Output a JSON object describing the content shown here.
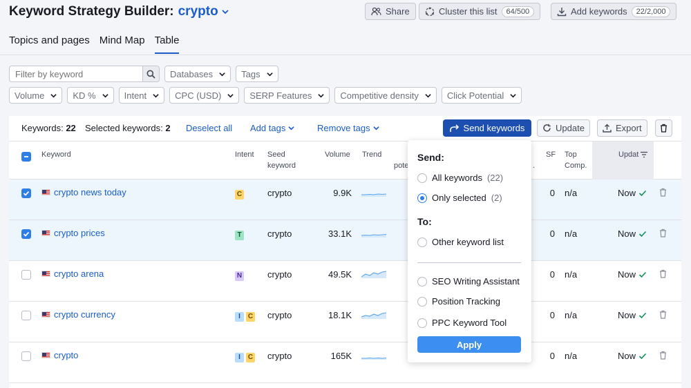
{
  "header": {
    "title": "Keyword Strategy Builder:",
    "project": "crypto",
    "share": "Share",
    "cluster": "Cluster this list",
    "cluster_count": "64/500",
    "add": "Add keywords",
    "add_count": "22/2,000"
  },
  "tabs": [
    {
      "label": "Topics and pages"
    },
    {
      "label": "Mind Map"
    },
    {
      "label": "Table",
      "active": true
    }
  ],
  "filters": {
    "search_placeholder": "Filter by keyword",
    "row1": [
      "Databases",
      "Tags"
    ],
    "row2": [
      "Volume",
      "KD %",
      "Intent",
      "CPC (USD)",
      "SERP Features",
      "Competitive density",
      "Click Potential"
    ]
  },
  "toolbar": {
    "keywords_label": "Keywords:",
    "keywords_count": "22",
    "selected_label": "Selected keywords:",
    "selected_count": "2",
    "deselect": "Deselect all",
    "add_tags": "Add tags",
    "remove_tags": "Remove tags",
    "send": "Send keywords",
    "update": "Update",
    "export": "Export"
  },
  "columns": {
    "keyword": "Keyword",
    "intent": "Intent",
    "seed1": "Seed",
    "seed2": "keyword",
    "volume": "Volume",
    "trend": "Trend",
    "potential_partial": "pote",
    "kd_partial": ".",
    "sf": "SF",
    "top1": "Top",
    "top2": "Comp.",
    "updated_partial": "Updat"
  },
  "rows": [
    {
      "keyword": "crypto news today",
      "intents": [
        "C"
      ],
      "seed": "crypto",
      "volume": "9.9K",
      "sf": "0",
      "comp": "n/a",
      "updated": "Now",
      "selected": true
    },
    {
      "keyword": "crypto prices",
      "intents": [
        "T"
      ],
      "seed": "crypto",
      "volume": "33.1K",
      "sf": "0",
      "comp": "n/a",
      "updated": "Now",
      "selected": true
    },
    {
      "keyword": "crypto arena",
      "intents": [
        "N"
      ],
      "seed": "crypto",
      "volume": "49.5K",
      "sf": "0",
      "comp": "n/a",
      "updated": "Now",
      "selected": false
    },
    {
      "keyword": "crypto currency",
      "intents": [
        "I",
        "C"
      ],
      "seed": "crypto",
      "volume": "18.1K",
      "sf": "0",
      "comp": "n/a",
      "updated": "Now",
      "selected": false
    },
    {
      "keyword": "crypto",
      "intents": [
        "I",
        "C"
      ],
      "seed": "crypto",
      "volume": "165K",
      "sf": "0",
      "comp": "n/a",
      "updated": "Now",
      "selected": false
    }
  ],
  "popup": {
    "send_heading": "Send:",
    "all_label": "All keywords",
    "all_count": "(22)",
    "selected_label": "Only selected",
    "selected_count": "(2)",
    "to_heading": "To:",
    "other_list": "Other keyword list",
    "tools": [
      "SEO Writing Assistant",
      "Position Tracking",
      "PPC Keyword Tool"
    ],
    "apply": "Apply"
  },
  "colors": {
    "accent": "#1a5dc9",
    "primary_button": "#1c4fb0",
    "apply_button": "#3c8ef0",
    "selected_row": "#eef6fd"
  }
}
